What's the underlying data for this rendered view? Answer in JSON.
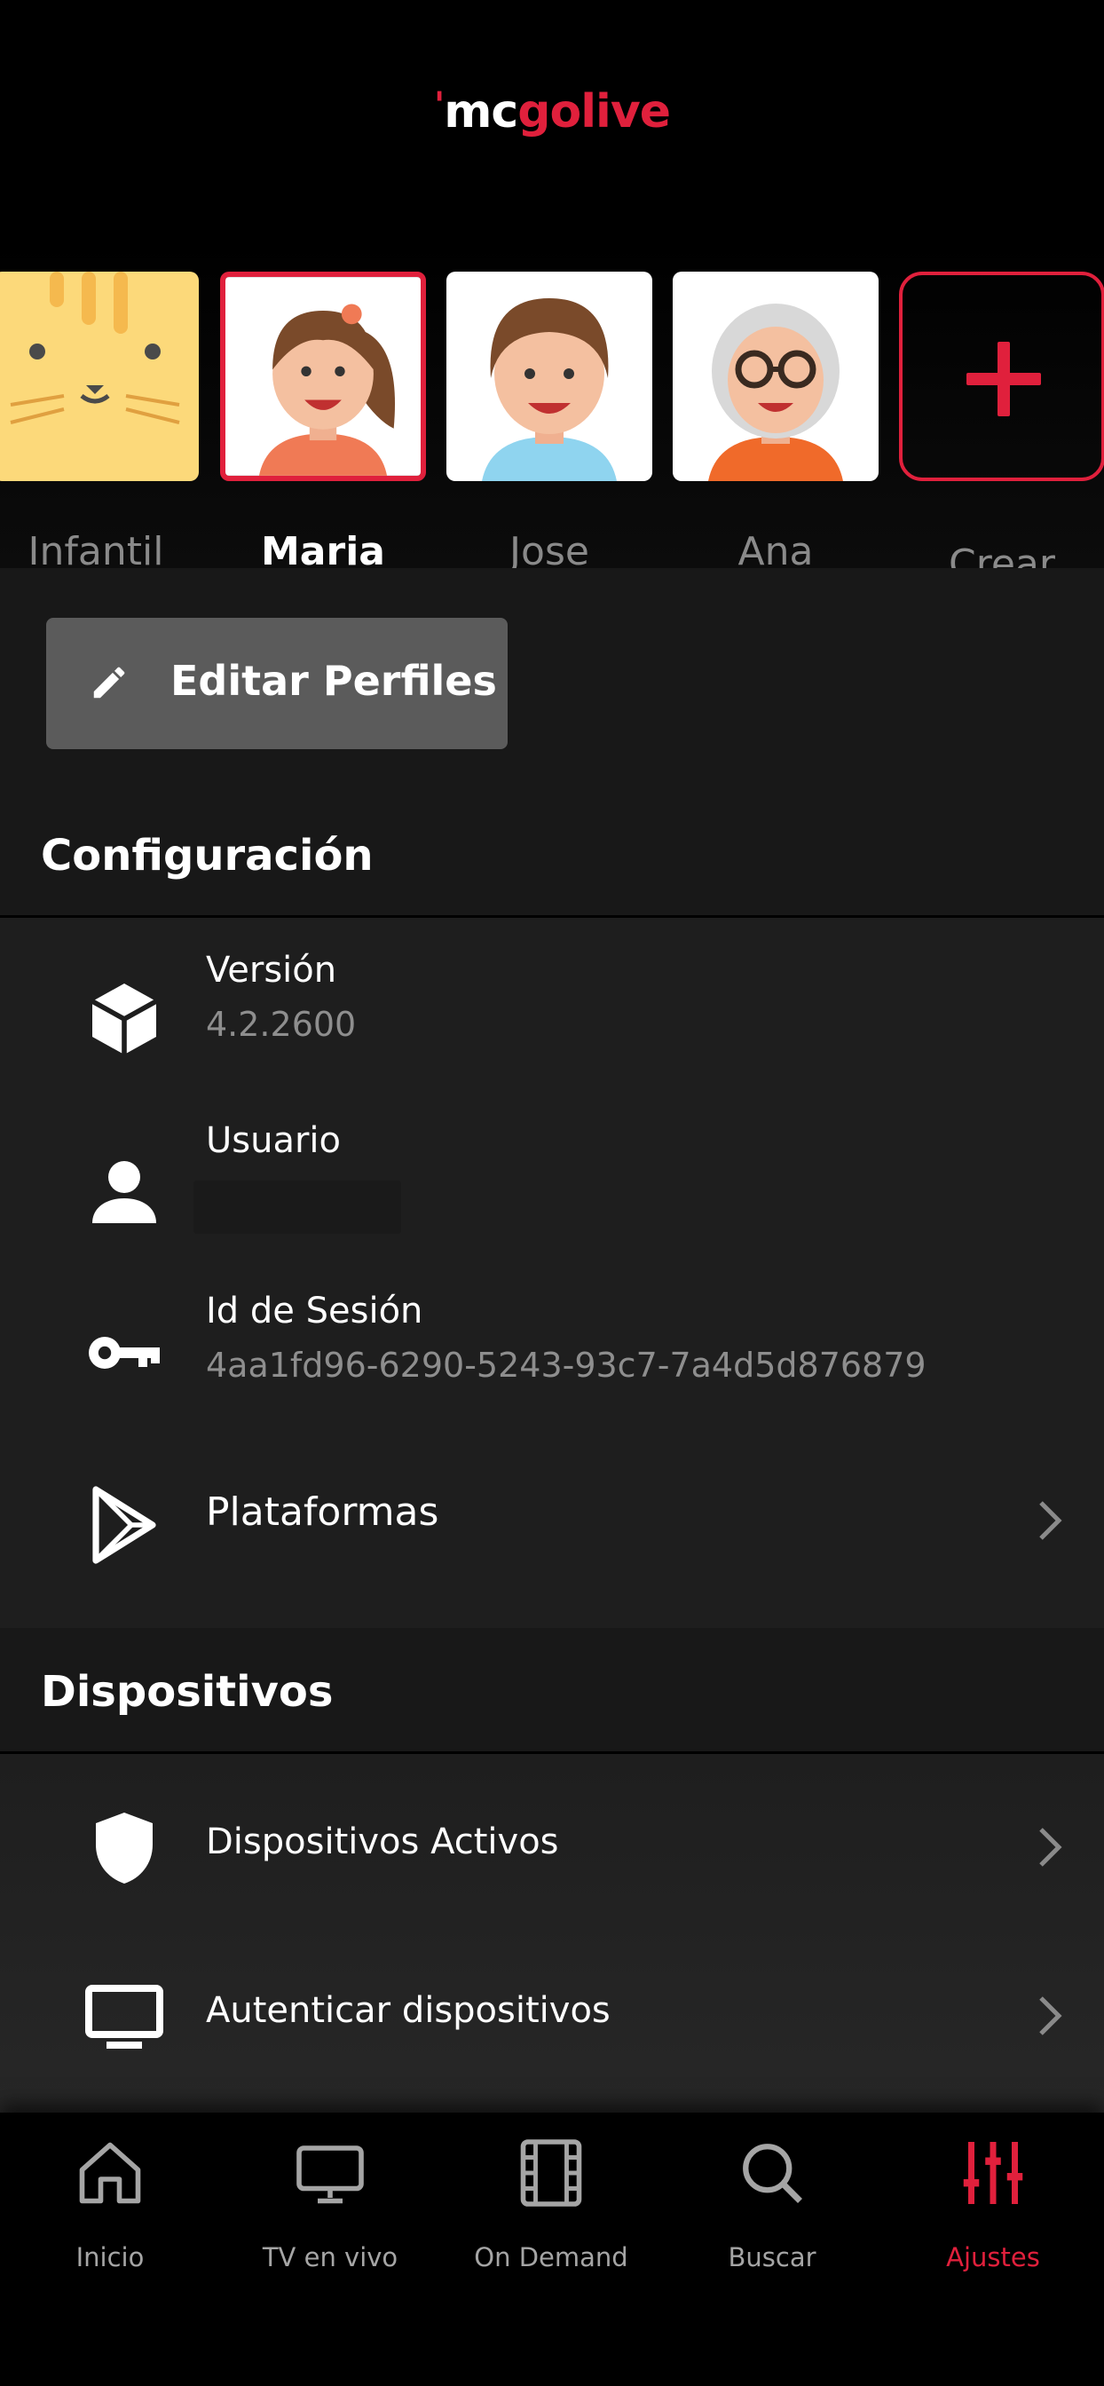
{
  "app": {
    "logo_part1": "mc",
    "logo_part2": "golive"
  },
  "profiles": [
    {
      "name": "Infantil",
      "icon": "cat-avatar-icon",
      "selected": false
    },
    {
      "name": "Maria",
      "icon": "girl-avatar-icon",
      "selected": true
    },
    {
      "name": "Jose",
      "icon": "boy-avatar-icon",
      "selected": false
    },
    {
      "name": "Ana",
      "icon": "grandma-avatar-icon",
      "selected": false
    },
    {
      "name": "Crear",
      "icon": "plus-icon",
      "selected": false
    }
  ],
  "edit_profiles": {
    "label": "Editar Perfiles",
    "icon": "pencil-icon"
  },
  "config": {
    "title": "Configuración",
    "version": {
      "label": "Versión",
      "value": "4.2.2600",
      "icon": "cube-icon"
    },
    "user": {
      "label": "Usuario",
      "value": "",
      "icon": "person-icon"
    },
    "session": {
      "label": "Id de Sesión",
      "value": "4aa1fd96-6290-5243-93c7-7a4d5d876879",
      "icon": "key-icon"
    },
    "platforms": {
      "label": "Plataformas",
      "icon": "play-store-icon"
    }
  },
  "devices": {
    "title": "Dispositivos",
    "active": {
      "label": "Dispositivos Activos",
      "icon": "shield-icon"
    },
    "authenticate": {
      "label": "Autenticar dispositivos",
      "icon": "monitor-icon"
    }
  },
  "nav": [
    {
      "label": "Inicio",
      "icon": "home-icon",
      "active": false
    },
    {
      "label": "TV en vivo",
      "icon": "tv-icon",
      "active": false
    },
    {
      "label": "On Demand",
      "icon": "film-icon",
      "active": false
    },
    {
      "label": "Buscar",
      "icon": "search-icon",
      "active": false
    },
    {
      "label": "Ajustes",
      "icon": "sliders-icon",
      "active": true
    }
  ],
  "colors": {
    "accent": "#e0203c",
    "background": "#000000",
    "panel": "#1e1e1e",
    "button": "#5b5b5b"
  }
}
